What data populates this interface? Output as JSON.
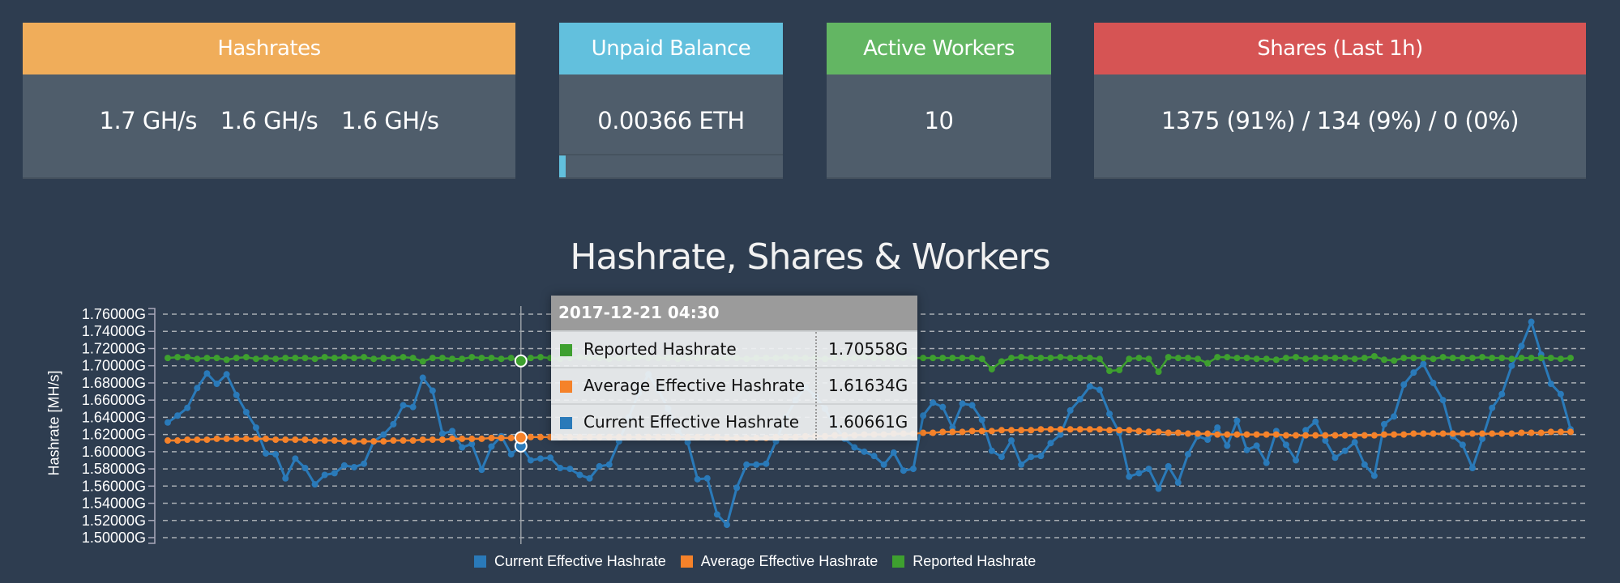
{
  "cards": {
    "hashrates": {
      "title": "Hashrates",
      "values": [
        "1.7 GH/s",
        "1.6 GH/s",
        "1.6 GH/s"
      ],
      "color": "#f0ad5a"
    },
    "unpaid_balance": {
      "title": "Unpaid Balance",
      "value": "0.00366 ETH",
      "color": "#62c0dd",
      "progress_percent": 3
    },
    "active_workers": {
      "title": "Active Workers",
      "value": "10",
      "color": "#63b663"
    },
    "shares": {
      "title": "Shares (Last 1h)",
      "value": "1375 (91%) / 134 (9%) / 0 (0%)",
      "color": "#d65454"
    }
  },
  "chart_data": {
    "type": "line",
    "title": "Hashrate, Shares & Workers",
    "ylabel": "Hashrate [MH/s]",
    "xlabel": "",
    "ylim": [
      1.5,
      1.76
    ],
    "yticks": [
      "1.50000G",
      "1.52000G",
      "1.54000G",
      "1.56000G",
      "1.58000G",
      "1.60000G",
      "1.62000G",
      "1.64000G",
      "1.66000G",
      "1.68000G",
      "1.70000G",
      "1.72000G",
      "1.74000G",
      "1.76000G"
    ],
    "grid": true,
    "legend_position": "bottom",
    "series": [
      {
        "name": "Current Effective Hashrate",
        "color": "#2a7ab9",
        "values": [
          1.634,
          1.642,
          1.651,
          1.674,
          1.691,
          1.679,
          1.69,
          1.666,
          1.646,
          1.628,
          1.598,
          1.597,
          1.569,
          1.592,
          1.581,
          1.562,
          1.573,
          1.575,
          1.584,
          1.582,
          1.586,
          1.612,
          1.62,
          1.632,
          1.654,
          1.652,
          1.686,
          1.671,
          1.621,
          1.624,
          1.605,
          1.609,
          1.579,
          1.606,
          1.618,
          1.597,
          1.6066,
          1.59,
          1.592,
          1.593,
          1.581,
          1.58,
          1.573,
          1.569,
          1.583,
          1.585,
          1.612,
          1.64,
          1.668,
          1.69,
          1.672,
          1.65,
          1.625,
          1.611,
          1.568,
          1.569,
          1.527,
          1.515,
          1.558,
          1.585,
          1.585,
          1.586,
          1.612,
          1.64,
          1.66,
          1.675,
          1.665,
          1.65,
          1.63,
          1.615,
          1.605,
          1.6,
          1.595,
          1.585,
          1.599,
          1.578,
          1.58,
          1.642,
          1.657,
          1.652,
          1.628,
          1.656,
          1.654,
          1.637,
          1.601,
          1.594,
          1.613,
          1.585,
          1.594,
          1.595,
          1.61,
          1.62,
          1.648,
          1.661,
          1.676,
          1.672,
          1.644,
          1.622,
          1.571,
          1.575,
          1.58,
          1.557,
          1.583,
          1.564,
          1.597,
          1.618,
          1.614,
          1.628,
          1.607,
          1.636,
          1.602,
          1.607,
          1.587,
          1.624,
          1.608,
          1.59,
          1.625,
          1.635,
          1.613,
          1.593,
          1.601,
          1.611,
          1.585,
          1.572,
          1.632,
          1.641,
          1.678,
          1.692,
          1.702,
          1.68,
          1.66,
          1.618,
          1.608,
          1.581,
          1.615,
          1.651,
          1.667,
          1.7,
          1.723,
          1.751,
          1.713,
          1.679,
          1.667,
          1.626
        ]
      },
      {
        "name": "Average Effective Hashrate",
        "color": "#f5822a",
        "values": [
          1.613,
          1.613,
          1.614,
          1.614,
          1.614,
          1.615,
          1.615,
          1.615,
          1.615,
          1.615,
          1.615,
          1.614,
          1.614,
          1.614,
          1.614,
          1.613,
          1.613,
          1.613,
          1.612,
          1.612,
          1.612,
          1.612,
          1.612,
          1.613,
          1.613,
          1.613,
          1.614,
          1.614,
          1.614,
          1.615,
          1.615,
          1.615,
          1.615,
          1.616,
          1.616,
          1.616,
          1.6163,
          1.617,
          1.617,
          1.617,
          1.617,
          1.617,
          1.617,
          1.617,
          1.617,
          1.617,
          1.617,
          1.617,
          1.617,
          1.617,
          1.617,
          1.617,
          1.617,
          1.617,
          1.617,
          1.617,
          1.617,
          1.616,
          1.616,
          1.616,
          1.616,
          1.616,
          1.617,
          1.617,
          1.617,
          1.618,
          1.618,
          1.618,
          1.619,
          1.619,
          1.619,
          1.62,
          1.62,
          1.62,
          1.621,
          1.621,
          1.621,
          1.622,
          1.622,
          1.623,
          1.623,
          1.623,
          1.624,
          1.624,
          1.624,
          1.625,
          1.625,
          1.625,
          1.625,
          1.626,
          1.626,
          1.626,
          1.626,
          1.626,
          1.626,
          1.626,
          1.625,
          1.625,
          1.625,
          1.624,
          1.623,
          1.623,
          1.622,
          1.622,
          1.621,
          1.621,
          1.621,
          1.62,
          1.62,
          1.62,
          1.62,
          1.62,
          1.62,
          1.62,
          1.619,
          1.619,
          1.619,
          1.619,
          1.619,
          1.619,
          1.619,
          1.619,
          1.619,
          1.619,
          1.62,
          1.62,
          1.62,
          1.621,
          1.621,
          1.621,
          1.621,
          1.621,
          1.621,
          1.621,
          1.621,
          1.621,
          1.621,
          1.621,
          1.622,
          1.622,
          1.622,
          1.623,
          1.623,
          1.623
        ]
      },
      {
        "name": "Reported Hashrate",
        "color": "#3ea02f",
        "values": [
          1.709,
          1.71,
          1.71,
          1.708,
          1.709,
          1.709,
          1.707,
          1.709,
          1.71,
          1.708,
          1.709,
          1.708,
          1.709,
          1.709,
          1.709,
          1.708,
          1.71,
          1.709,
          1.71,
          1.709,
          1.71,
          1.708,
          1.709,
          1.709,
          1.71,
          1.709,
          1.705,
          1.709,
          1.709,
          1.708,
          1.708,
          1.71,
          1.709,
          1.709,
          1.708,
          1.709,
          1.7056,
          1.709,
          1.71,
          1.709,
          1.708,
          1.709,
          1.71,
          1.709,
          1.709,
          1.708,
          1.709,
          1.709,
          1.71,
          1.709,
          1.709,
          1.709,
          1.708,
          1.709,
          1.709,
          1.71,
          1.709,
          1.709,
          1.709,
          1.708,
          1.709,
          1.709,
          1.709,
          1.71,
          1.709,
          1.709,
          1.709,
          1.708,
          1.709,
          1.709,
          1.709,
          1.71,
          1.709,
          1.709,
          1.709,
          1.709,
          1.709,
          1.709,
          1.709,
          1.709,
          1.709,
          1.709,
          1.709,
          1.708,
          1.696,
          1.705,
          1.709,
          1.71,
          1.709,
          1.709,
          1.709,
          1.71,
          1.709,
          1.709,
          1.709,
          1.708,
          1.694,
          1.695,
          1.708,
          1.709,
          1.708,
          1.693,
          1.71,
          1.709,
          1.709,
          1.708,
          1.703,
          1.71,
          1.71,
          1.709,
          1.709,
          1.708,
          1.708,
          1.707,
          1.709,
          1.71,
          1.708,
          1.709,
          1.709,
          1.709,
          1.709,
          1.708,
          1.709,
          1.711,
          1.707,
          1.706,
          1.709,
          1.709,
          1.709,
          1.708,
          1.71,
          1.709,
          1.709,
          1.709,
          1.71,
          1.709,
          1.709,
          1.708,
          1.709,
          1.709,
          1.709,
          1.709,
          1.708,
          1.709
        ]
      }
    ],
    "tooltip": {
      "timestamp": "2017-12-21 04:30",
      "hover_index": 36,
      "rows": [
        {
          "name": "Reported Hashrate",
          "value": "1.70558G",
          "color": "#3ea02f"
        },
        {
          "name": "Average Effective Hashrate",
          "value": "1.61634G",
          "color": "#f5822a"
        },
        {
          "name": "Current Effective Hashrate",
          "value": "1.60661G",
          "color": "#2a7ab9"
        }
      ]
    }
  }
}
